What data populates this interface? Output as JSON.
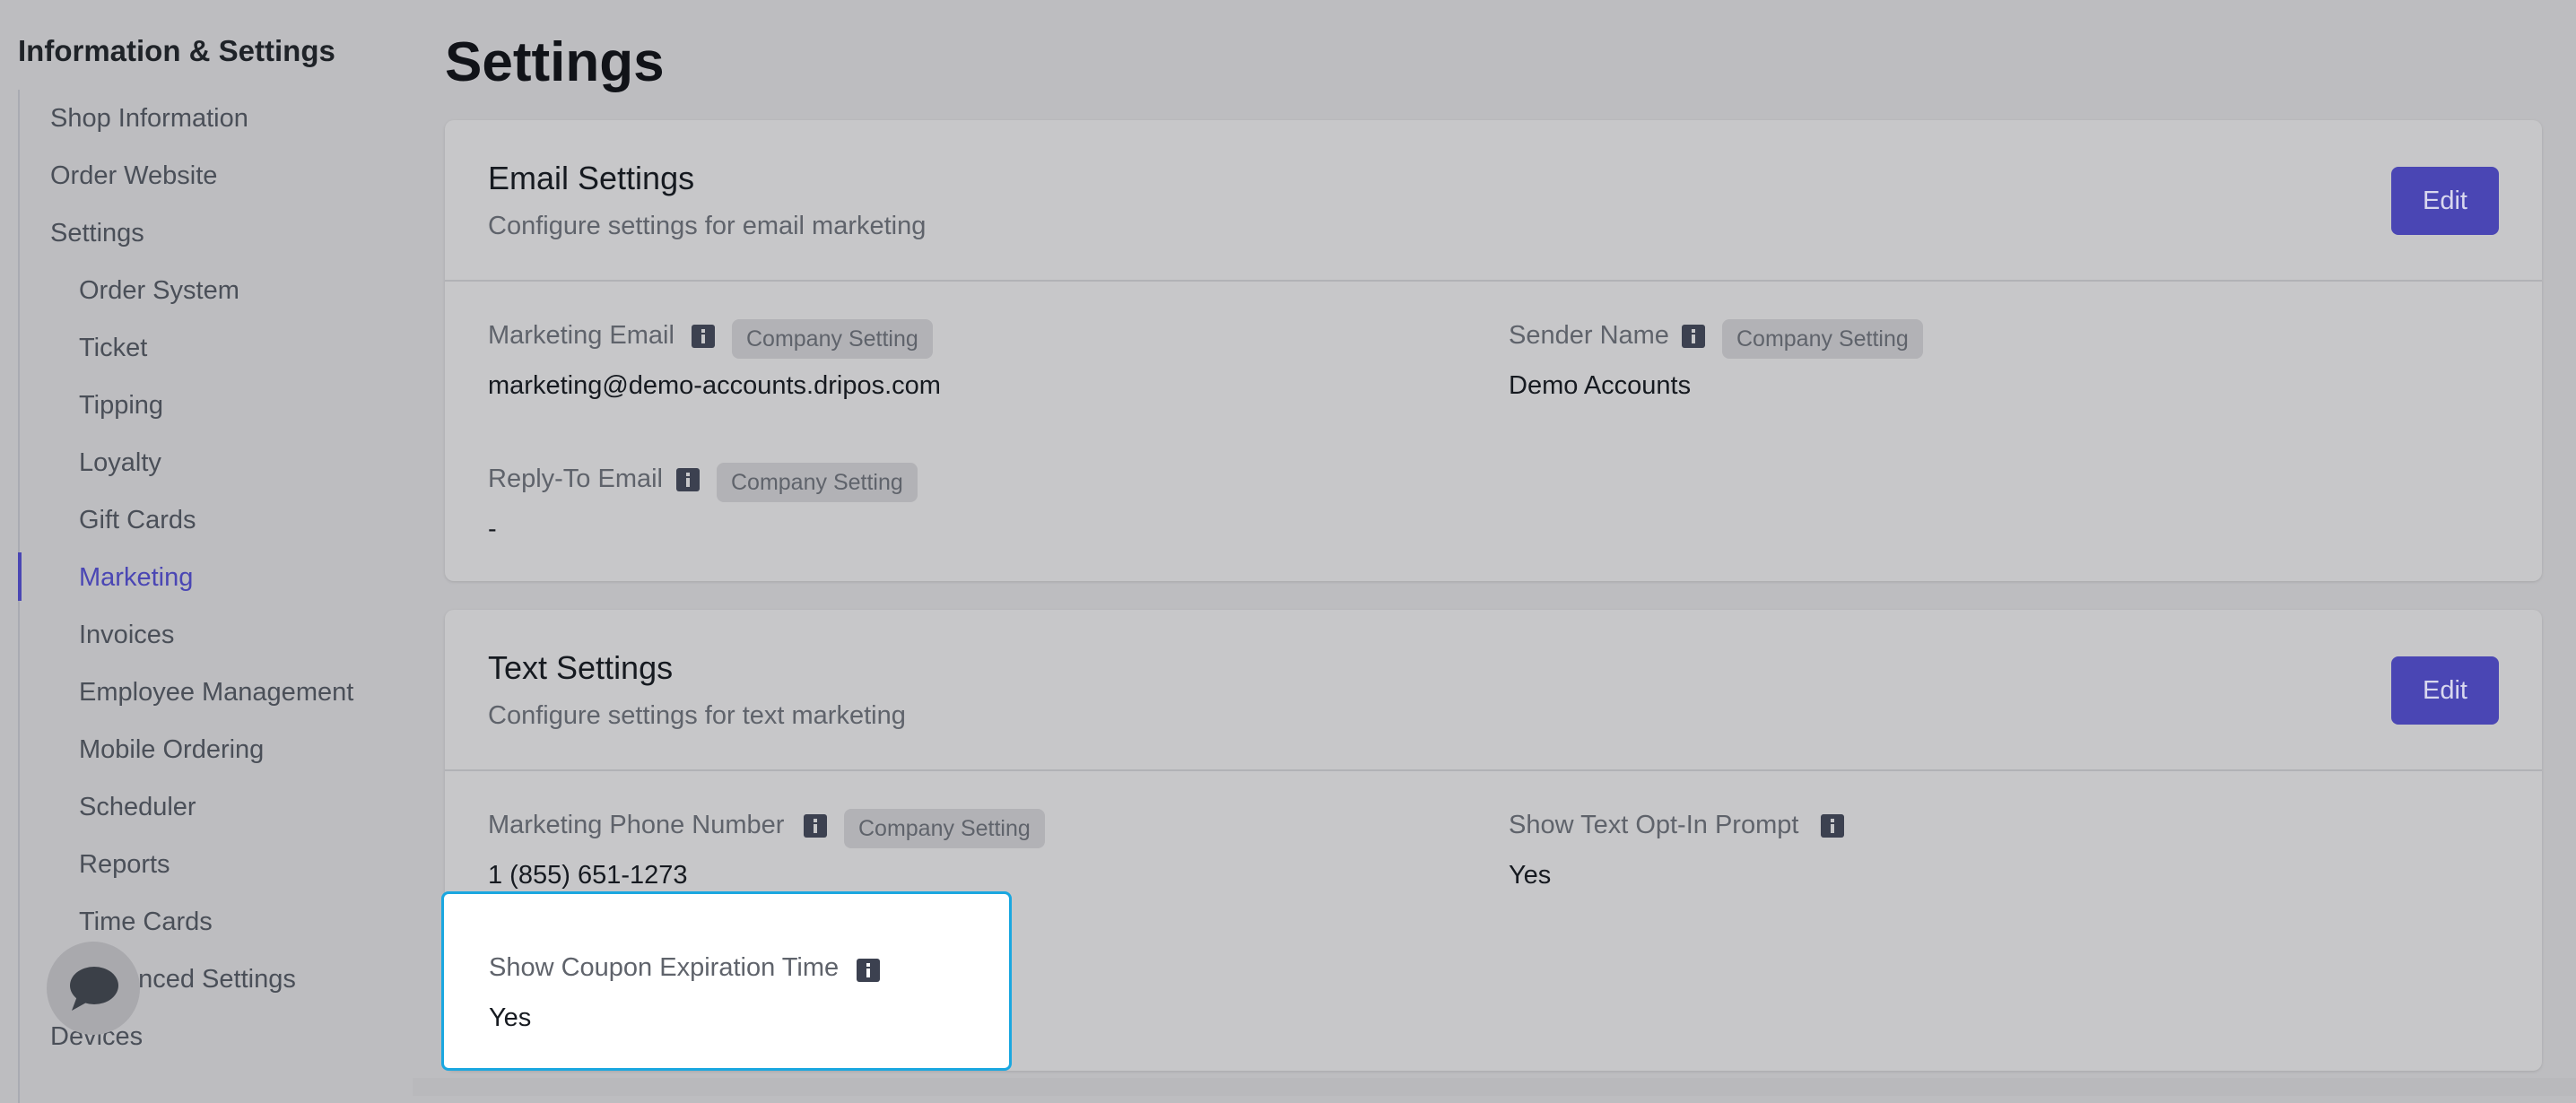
{
  "sidebar": {
    "title": "Information & Settings",
    "items": [
      {
        "label": "Shop Information"
      },
      {
        "label": "Order Website"
      },
      {
        "label": "Settings"
      },
      {
        "label": "Order System"
      },
      {
        "label": "Ticket"
      },
      {
        "label": "Tipping"
      },
      {
        "label": "Loyalty"
      },
      {
        "label": "Gift Cards"
      },
      {
        "label": "Marketing"
      },
      {
        "label": "Invoices"
      },
      {
        "label": "Employee Management"
      },
      {
        "label": "Mobile Ordering"
      },
      {
        "label": "Scheduler"
      },
      {
        "label": "Reports"
      },
      {
        "label": "Time Cards"
      },
      {
        "label": "Advanced Settings"
      },
      {
        "label": "Devices"
      }
    ],
    "active_item": "Marketing"
  },
  "page": {
    "title": "Settings"
  },
  "email_settings": {
    "title": "Email Settings",
    "subtitle": "Configure settings for email marketing",
    "edit_label": "Edit",
    "fields": [
      {
        "label": "Marketing Email",
        "badge": "Company Setting",
        "value": "marketing@demo-accounts.dripos.com"
      },
      {
        "label": "Sender Name",
        "badge": "Company Setting",
        "value": "Demo Accounts"
      },
      {
        "label": "Reply-To Email",
        "badge": "Company Setting",
        "value": "-"
      }
    ]
  },
  "text_settings": {
    "title": "Text Settings",
    "subtitle": "Configure settings for text marketing",
    "edit_label": "Edit",
    "fields": [
      {
        "label": "Marketing Phone Number",
        "badge": "Company Setting",
        "value": "1 (855) 651-1273"
      },
      {
        "label": "Show Text Opt-In Prompt",
        "value": "Yes"
      },
      {
        "label": "Show Coupon Expiration Time",
        "value": "Yes"
      }
    ]
  },
  "colors": {
    "accent": "#4a46b4",
    "highlight_border": "#1aa7e0",
    "overlay_background": "#bdbdc0"
  },
  "icons": {
    "info": "info-icon",
    "chat": "chat-bubble-icon"
  }
}
